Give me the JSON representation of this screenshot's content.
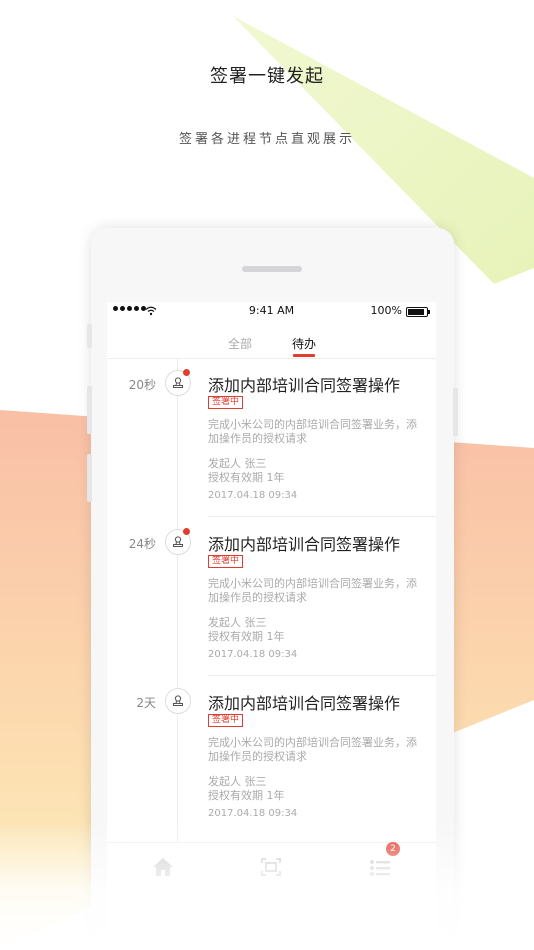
{
  "headline": "签署一键发起",
  "subline": "签署各进程节点直观展示",
  "status_bar": {
    "time": "9:41 AM",
    "battery": "100%"
  },
  "tabs": [
    {
      "label": "全部"
    },
    {
      "label": "待办"
    }
  ],
  "active_tab": "待办",
  "items": [
    {
      "age": "20秒",
      "title": "添加内部培训合同签署操作",
      "badge": "签署中",
      "desc": "完成小米公司的内部培训合同签署业务，添加操作员的授权请求",
      "initiator": "发起人 张三",
      "validity": "授权有效期 1年",
      "date": "2017.04.18 09:34",
      "unread": true
    },
    {
      "age": "24秒",
      "title": "添加内部培训合同签署操作",
      "badge": "签署中",
      "desc": "完成小米公司的内部培训合同签署业务，添加操作员的授权请求",
      "initiator": "发起人 张三",
      "validity": "授权有效期 1年",
      "date": "2017.04.18 09:34",
      "unread": true
    },
    {
      "age": "2天",
      "title": "添加内部培训合同签署操作",
      "badge": "签署中",
      "desc": "完成小米公司的内部培训合同签署业务，添加操作员的授权请求",
      "initiator": "发起人 张三",
      "validity": "授权有效期 1年",
      "date": "2017.04.18 09:34",
      "unread": false
    }
  ],
  "bottom_nav": [
    {
      "icon": "home-icon"
    },
    {
      "icon": "scan-icon"
    },
    {
      "icon": "task-list-icon",
      "badge": "2"
    }
  ],
  "colors": {
    "accent": "#e03c31",
    "bg_green": "#ecf5c4",
    "bg_orange": "#f9c8a7",
    "bg_yellow": "#fbe9b8"
  }
}
